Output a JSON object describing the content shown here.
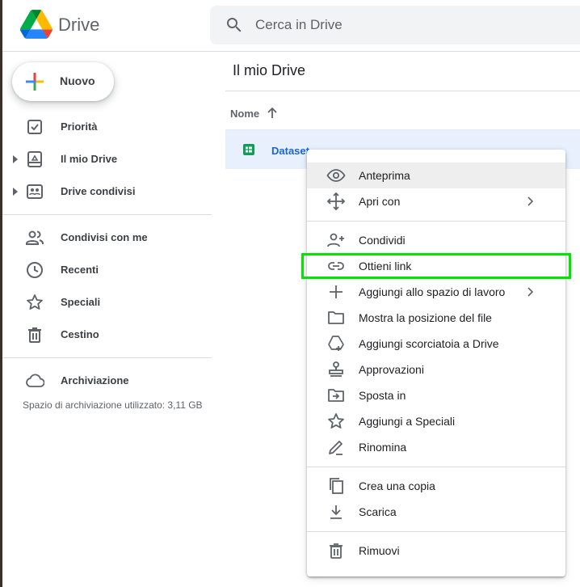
{
  "header": {
    "brand": "Drive",
    "search_placeholder": "Cerca in Drive"
  },
  "sidebar": {
    "new_button": "Nuovo",
    "items": [
      {
        "label": "Priorità",
        "icon": "priority-icon"
      },
      {
        "label": "Il mio Drive",
        "icon": "my-drive-icon",
        "expandable": true
      },
      {
        "label": "Drive condivisi",
        "icon": "shared-drives-icon",
        "expandable": true
      },
      {
        "label": "Condivisi con me",
        "icon": "people-icon"
      },
      {
        "label": "Recenti",
        "icon": "clock-icon"
      },
      {
        "label": "Speciali",
        "icon": "star-icon"
      },
      {
        "label": "Cestino",
        "icon": "trash-icon"
      },
      {
        "label": "Archiviazione",
        "icon": "cloud-icon"
      }
    ],
    "storage_text": "Spazio di archiviazione utilizzato: 3,11 GB"
  },
  "main": {
    "title": "Il mio Drive",
    "column_name": "Nome",
    "files": [
      {
        "name": "Dataset",
        "type": "sheets"
      }
    ]
  },
  "context_menu": {
    "items": [
      {
        "label": "Anteprima",
        "icon": "eye-icon"
      },
      {
        "label": "Apri con",
        "icon": "move-icon",
        "submenu": true
      },
      {
        "label": "Condividi",
        "icon": "person-add-icon"
      },
      {
        "label": "Ottieni link",
        "icon": "link-icon",
        "highlighted": true
      },
      {
        "label": "Aggiungi allo spazio di lavoro",
        "icon": "plus-icon",
        "submenu": true
      },
      {
        "label": "Mostra la posizione del file",
        "icon": "folder-icon"
      },
      {
        "label": "Aggiungi scorciatoia a Drive",
        "icon": "drive-shortcut-icon"
      },
      {
        "label": "Approvazioni",
        "icon": "stamp-icon"
      },
      {
        "label": "Sposta in",
        "icon": "move-to-icon"
      },
      {
        "label": "Aggiungi a Speciali",
        "icon": "star-icon"
      },
      {
        "label": "Rinomina",
        "icon": "pencil-icon"
      },
      {
        "label": "Crea una copia",
        "icon": "copy-icon"
      },
      {
        "label": "Scarica",
        "icon": "download-icon"
      },
      {
        "label": "Rimuovi",
        "icon": "trash-icon"
      }
    ]
  },
  "colors": {
    "highlight_box": "#00e600",
    "selected_row": "#e8f0fe",
    "file_link": "#1967d2"
  }
}
